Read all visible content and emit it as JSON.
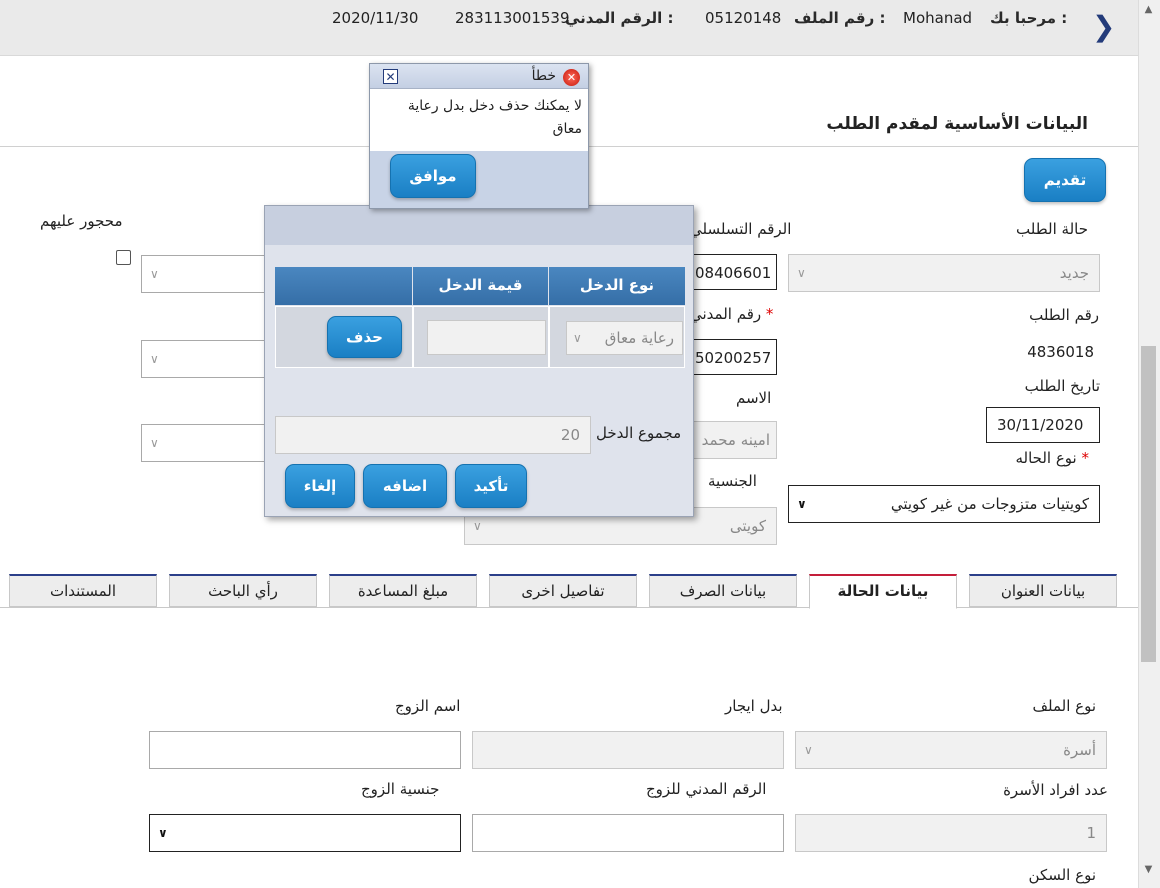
{
  "header": {
    "welcome_label": "مرحبا بك :",
    "user_name": "Mohanad",
    "file_no_label": "رقم الملف :",
    "file_no": "05120148",
    "civil_id_label": "الرقم المدني :",
    "civil_id": "283113001539",
    "date": "2020/11/30"
  },
  "section": {
    "title": "البيانات الأساسية لمقدم الطلب",
    "submit_label": "تقديم"
  },
  "form": {
    "request_status_label": "حالة الطلب",
    "request_status_value": "جديد",
    "serial_label": "الرقم التسلسلي",
    "serial_value": "08406601",
    "restricted_label": "محجور عليهم",
    "request_no_label": "رقم الطلب",
    "request_no_value": "4836018",
    "civil_no_label": "رقم المدني",
    "civil_no_value": "50200257",
    "request_date_label": "تاريخ الطلب",
    "request_date_value": "30/11/2020",
    "name_label": "الاسم",
    "name_value": "امينه محمد",
    "case_type_label": "نوع الحاله",
    "case_type_value": "كويتيات متزوجات من غير كويتي",
    "nationality_label": "الجنسية",
    "nationality_value": "كويتى"
  },
  "tabs": [
    {
      "label": "بيانات العنوان"
    },
    {
      "label": "بيانات الحالة"
    },
    {
      "label": "بيانات الصرف"
    },
    {
      "label": "تفاصيل اخرى"
    },
    {
      "label": "مبلغ المساعدة"
    },
    {
      "label": "رأي الباحث"
    },
    {
      "label": "المستندات"
    }
  ],
  "case_tab": {
    "file_type_label": "نوع الملف",
    "file_type_value": "أسرة",
    "rent_allowance_label": "بدل ايجار",
    "husband_name_label": "اسم الزوج",
    "family_count_label": "عدد افراد الأسرة",
    "family_count_value": "1",
    "husband_civil_label": "الرقم المدني للزوج",
    "husband_nationality_label": "جنسية الزوج",
    "housing_type_label": "نوع السكن"
  },
  "error_dialog": {
    "title": "خطأ",
    "message": "لا يمكنك حذف دخل بدل رعاية معاق",
    "ok_label": "موافق"
  },
  "income_dialog": {
    "col_income_type": "نوع الدخل",
    "col_income_value": "قيمة الدخل",
    "row_income_type": "رعاية معاق",
    "delete_label": "حذف",
    "total_label": "مجموع الدخل",
    "total_value": "20",
    "confirm_label": "تأكيد",
    "add_label": "اضافه",
    "cancel_label": "إلغاء"
  }
}
